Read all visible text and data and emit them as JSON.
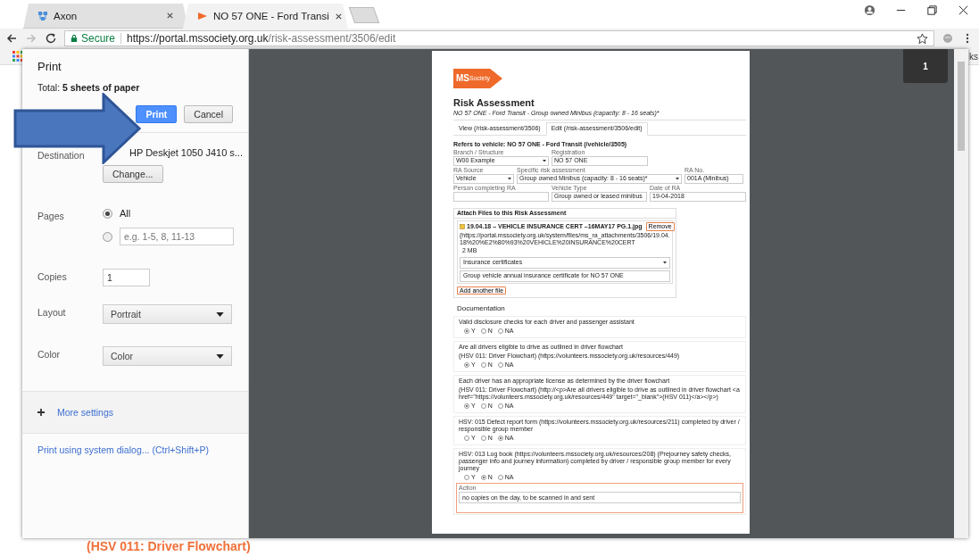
{
  "browser": {
    "tabs": [
      {
        "title": "Axon",
        "selected": false
      },
      {
        "title": "NO 57 ONE - Ford Transi",
        "selected": true
      }
    ],
    "address": {
      "secure": "Secure",
      "host": "https://portal.mssociety.org.uk",
      "path": "/risk-assessment/3506/edit"
    },
    "bookmarks_text": "ks"
  },
  "print": {
    "title": "Print",
    "total": "Total: **5 sheets of paper**",
    "buttons": [
      {
        "label": "Print",
        "kind": "primary"
      },
      {
        "label": "Cancel",
        "kind": "secondary"
      }
    ],
    "destination": {
      "label": "Destination",
      "value": "HP Deskjet 1050 J410 s...",
      "button": "Change..."
    },
    "pages": {
      "label": "Pages",
      "options": [
        {
          "kind": "all",
          "label": "All",
          "selected": true
        },
        {
          "kind": "custom",
          "placeholder": "e.g. 1-5, 8, 11-13",
          "selected": false
        }
      ]
    },
    "copies": {
      "label": "Copies",
      "value": "1"
    },
    "layout": {
      "label": "Layout",
      "value": "Portrait"
    },
    "color": {
      "label": "Color",
      "value": "Color"
    },
    "more_settings": "More settings",
    "system_dialog": "Print using system dialog... (Ctrl+Shift+P)"
  },
  "preview": {
    "page_number": "1",
    "document": {
      "logo": {
        "ms": "MS",
        "society": "Society"
      },
      "title": "Risk Assessment",
      "subtitle": "NO 57 ONE - Ford Transit - Group owned Minibus (capacity: 8 - 16 seats)*",
      "tabs": [
        {
          "label": "View (/risk-assessment/3506)",
          "selected": false
        },
        {
          "label": "Edit (/risk-assessment/3506/edit)",
          "selected": true
        }
      ],
      "heading": "Refers to vehicle: NO 57 ONE - Ford Transit (/vehicle/3505)",
      "field_rows": [
        [
          {
            "label": "Branch / Structure",
            "value": "W00 Example",
            "kind": "select"
          },
          {
            "label": "Registration",
            "value": "NO 57 ONE",
            "kind": "text"
          }
        ],
        [
          {
            "label": "RA Source",
            "value": "Vehicle",
            "kind": "select"
          },
          {
            "label": "Specific risk assessment",
            "value": "Group owned Minibus (capacity: 8 - 16 seats)*",
            "kind": "select"
          },
          {
            "label": "RA No.",
            "value": "001A (Minibus)",
            "kind": "text"
          }
        ],
        [
          {
            "label": "Person completing RA",
            "kind": "text"
          },
          {
            "label": "Vehicle Type",
            "value": "Group owned or leased minibus",
            "kind": "text"
          },
          {
            "label": "Date of RA",
            "value": "19-04-2018",
            "kind": "text"
          }
        ]
      ],
      "attach": {
        "title": "Attach Files to this Risk Assessment",
        "file": "19.04.18 – VEHICLE INSURANCE CERT –16MAY17 PG.1.jpg",
        "remove": "Remove",
        "url": "(https://portal.mssociety.org.uk/system/files/ms_ra_attachments/3506/19.04.18%20%E2%80%93%20VEHICLE%20INSURANCE%20CERT",
        "size": "2 MB",
        "category": "Insurance certificates",
        "description": "Group vehicle annual insurance certificate for NO 57 ONE",
        "add": "Add another file"
      },
      "documentation_heading": "Documentation",
      "questions": [
        {
          "lines": [
            "Valid disclosure checks for each driver and passenger assistant"
          ],
          "options": [
            {
              "label": "Y",
              "selected": true
            },
            {
              "label": "N",
              "selected": false
            },
            {
              "label": "NA",
              "selected": false
            }
          ]
        },
        {
          "lines": [
            "Are all drivers eligible to drive as outlined in driver flowchart",
            "(HSV 011: Driver Flowchart) (https://volunteers.mssociety.org.uk/resources/449)"
          ],
          "options": [
            {
              "label": "Y",
              "selected": true
            },
            {
              "label": "N",
              "selected": false
            },
            {
              "label": "NA",
              "selected": false
            }
          ]
        },
        {
          "lines": [
            "Each driver has an appropriate license as determined by the driver flowchart",
            "(HSV 011: Driver Flowchart) (http://<p>Are all drivers eligible to drive as outlined in driver flowchart <a href=\"https://volunteers.mssociety.org.uk/resources/449\" target=\"_blank\">(HSV 011)</a></p>)"
          ],
          "options": [
            {
              "label": "Y",
              "selected": true
            },
            {
              "label": "N",
              "selected": false
            },
            {
              "label": "NA",
              "selected": false
            }
          ]
        },
        {
          "lines": [
            "HSV: 015 Defect report form (https://volunteers.mssociety.org.uk/resources/211) completed by driver / responsible group member"
          ],
          "options": [
            {
              "label": "Y",
              "selected": false
            },
            {
              "label": "N",
              "selected": false
            },
            {
              "label": "NA",
              "selected": true
            }
          ]
        },
        {
          "lines": [
            "HSV: 013  Log book (https://volunteers.mssociety.org.uk/resources/208) (Prejourney safety checks, passenger info and journey information) completed by driver / responsible group member for every journey"
          ],
          "options": [
            {
              "label": "Y",
              "selected": false
            },
            {
              "label": "N",
              "selected": true
            },
            {
              "label": "NA",
              "selected": false
            }
          ],
          "action": {
            "label": "Action",
            "value": "no copies on the day, to be scanned in and sent"
          }
        }
      ]
    }
  },
  "background_page": {
    "link": "(HSV 011: Driver Flowchart)"
  }
}
